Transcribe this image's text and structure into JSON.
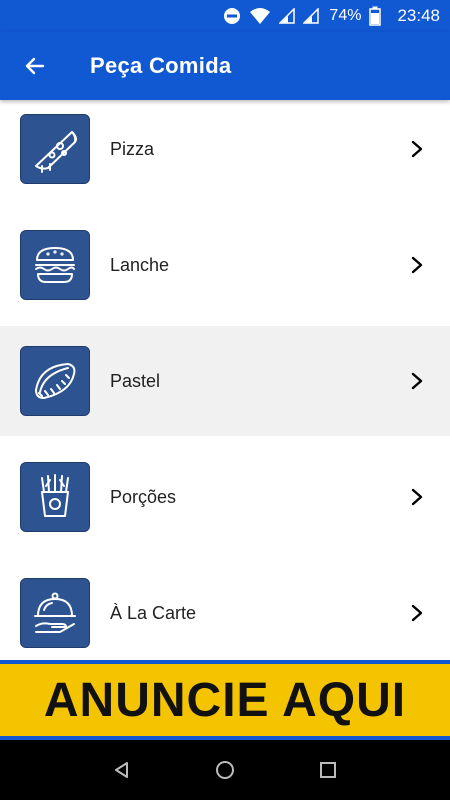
{
  "status_bar": {
    "battery_percent": "74%",
    "time": "23:48",
    "icons": [
      "do-not-disturb-icon",
      "wifi-icon",
      "signal-icon",
      "signal-icon",
      "battery-icon"
    ]
  },
  "app_bar": {
    "title": "Peça Comida",
    "back_icon": "arrow-left-icon"
  },
  "menu": {
    "items": [
      {
        "label": "Pizza",
        "icon": "pizza-icon"
      },
      {
        "label": "Lanche",
        "icon": "burger-icon"
      },
      {
        "label": "Pastel",
        "icon": "pastel-icon"
      },
      {
        "label": "Porções",
        "icon": "fries-icon"
      },
      {
        "label": "À La Carte",
        "icon": "cloche-icon"
      }
    ],
    "highlighted_index": 2
  },
  "ad": {
    "text": "ANUNCIE AQUI"
  },
  "colors": {
    "primary": "#1158d3",
    "thumb_bg": "#2d5490",
    "ad_yellow": "#f4c400",
    "highlight_row": "#f1f1f1"
  }
}
